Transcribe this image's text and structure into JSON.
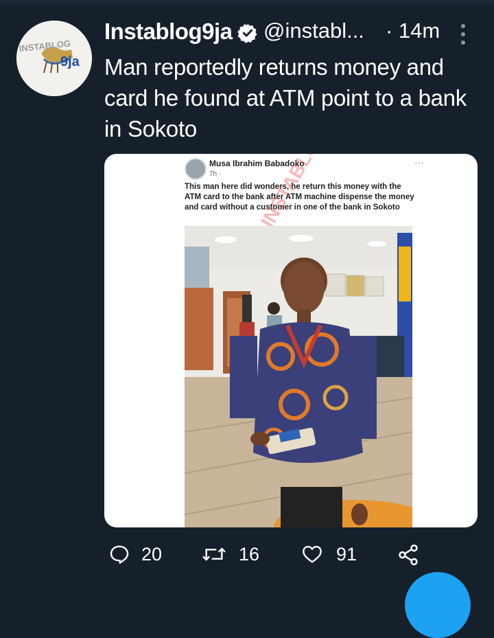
{
  "tweet": {
    "author_name": "Instablog9ja",
    "handle": "@instabl...",
    "time": "· 14m",
    "text": "Man reportedly returns money and card he found at ATM point to a bank in Sokoto"
  },
  "avatar": {
    "logo_text_top": "INSTABLOG",
    "logo_text_bottom": "9ja"
  },
  "embedded_post": {
    "author": "Musa Ibrahim Babadoko",
    "time": "7h · ",
    "more": "···",
    "text": "This man here did wonders, he return this money with the ATM card to the bank after ATM machine dispense the money and card without a customer in one of the bank in Sokoto",
    "watermark": "INSTABLOG"
  },
  "actions": {
    "replies": "20",
    "retweets": "16",
    "likes": "91"
  },
  "icons": {
    "verified": "verified-badge-icon",
    "more": "more-vertical-icon",
    "reply": "reply-icon",
    "retweet": "retweet-icon",
    "like": "heart-icon",
    "share": "share-icon",
    "compose": "compose-fab-icon"
  },
  "colors": {
    "background": "#15202b",
    "accent": "#1da1f2",
    "text": "#ffffff"
  }
}
